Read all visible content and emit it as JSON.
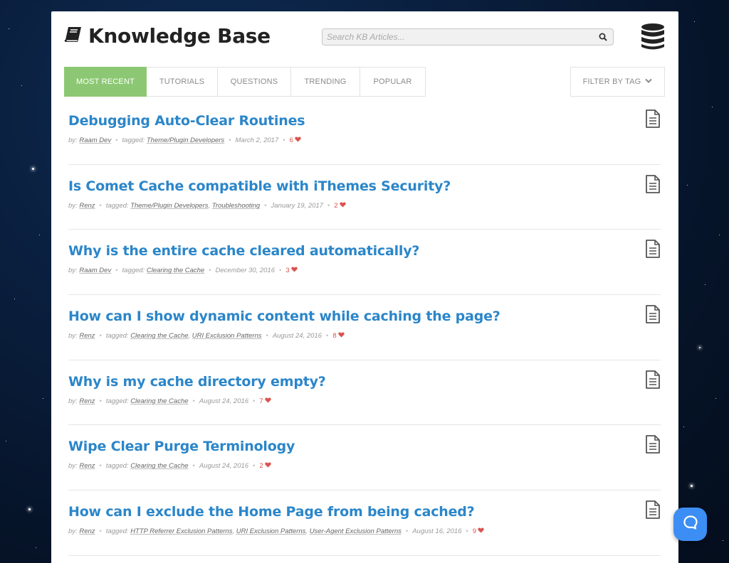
{
  "header": {
    "title": "Knowledge Base",
    "book_icon": "book-icon",
    "db_icon": "database-icon"
  },
  "search": {
    "placeholder": "Search KB Articles...",
    "value": ""
  },
  "tabs": [
    {
      "label": "Most Recent",
      "active": true
    },
    {
      "label": "Tutorials",
      "active": false
    },
    {
      "label": "Questions",
      "active": false
    },
    {
      "label": "Trending",
      "active": false
    },
    {
      "label": "Popular",
      "active": false
    }
  ],
  "filter": {
    "label": "Filter by Tag",
    "icon": "chevron-down-icon"
  },
  "meta_labels": {
    "by": "by:",
    "tagged": "tagged:"
  },
  "articles": [
    {
      "title": "Debugging Auto-Clear Routines",
      "author": "Raam Dev",
      "tags": [
        "Theme/Plugin Developers"
      ],
      "date": "March 2, 2017",
      "likes": "6"
    },
    {
      "title": "Is Comet Cache compatible with iThemes Security?",
      "author": "Renz",
      "tags": [
        "Theme/Plugin Developers",
        "Troubleshooting"
      ],
      "date": "January 19, 2017",
      "likes": "2"
    },
    {
      "title": "Why is the entire cache cleared automatically?",
      "author": "Raam Dev",
      "tags": [
        "Clearing the Cache"
      ],
      "date": "December 30, 2016",
      "likes": "3"
    },
    {
      "title": "How can I show dynamic content while caching the page?",
      "author": "Renz",
      "tags": [
        "Clearing the Cache",
        "URI Exclusion Patterns"
      ],
      "date": "August 24, 2016",
      "likes": "8"
    },
    {
      "title": "Why is my cache directory empty?",
      "author": "Renz",
      "tags": [
        "Clearing the Cache"
      ],
      "date": "August 24, 2016",
      "likes": "7"
    },
    {
      "title": "Wipe Clear Purge Terminology",
      "author": "Renz",
      "tags": [
        "Clearing the Cache"
      ],
      "date": "August 24, 2016",
      "likes": "2"
    },
    {
      "title": "How can I exclude the Home Page from being cached?",
      "author": "Renz",
      "tags": [
        "HTTP Referrer Exclusion Patterns",
        "URI Exclusion Patterns",
        "User-Agent Exclusion Patterns"
      ],
      "date": "August 16, 2016",
      "likes": "9"
    }
  ],
  "colors": {
    "accent_green": "#8cc873",
    "link_blue": "#2b86c9",
    "heart_red": "#d9534f",
    "chat_blue": "#3d8ef4"
  },
  "chat": {
    "icon": "chat-bubble-icon"
  }
}
